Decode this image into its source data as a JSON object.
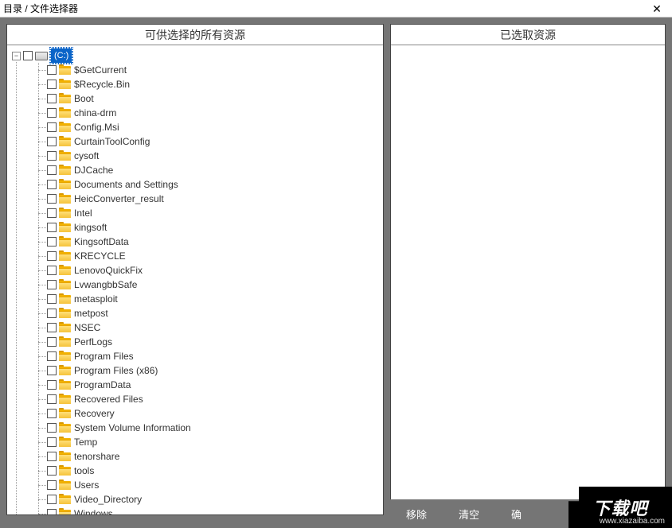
{
  "window": {
    "title": "目录 / 文件选择器"
  },
  "panels": {
    "left_header": "可供选择的所有资源",
    "right_header": "已选取资源"
  },
  "tree": {
    "root": {
      "label": "(C:)"
    },
    "nodes": [
      {
        "label": "$GetCurrent"
      },
      {
        "label": "$Recycle.Bin"
      },
      {
        "label": "Boot"
      },
      {
        "label": "china-drm"
      },
      {
        "label": "Config.Msi"
      },
      {
        "label": "CurtainToolConfig"
      },
      {
        "label": "cysoft"
      },
      {
        "label": "DJCache"
      },
      {
        "label": "Documents and Settings"
      },
      {
        "label": "HeicConverter_result"
      },
      {
        "label": "Intel"
      },
      {
        "label": "kingsoft"
      },
      {
        "label": "KingsoftData"
      },
      {
        "label": "KRECYCLE"
      },
      {
        "label": "LenovoQuickFix"
      },
      {
        "label": "LvwangbbSafe"
      },
      {
        "label": "metasploit"
      },
      {
        "label": "metpost"
      },
      {
        "label": "NSEC"
      },
      {
        "label": "PerfLogs"
      },
      {
        "label": "Program Files"
      },
      {
        "label": "Program Files (x86)"
      },
      {
        "label": "ProgramData"
      },
      {
        "label": "Recovered Files"
      },
      {
        "label": "Recovery"
      },
      {
        "label": "System Volume Information"
      },
      {
        "label": "Temp"
      },
      {
        "label": "tenorshare"
      },
      {
        "label": "tools"
      },
      {
        "label": "Users"
      },
      {
        "label": "Video_Directory"
      },
      {
        "label": "Windows"
      }
    ]
  },
  "buttons": {
    "remove": "移除",
    "clear": "清空",
    "confirm": "确"
  },
  "watermark": {
    "logo_text": "下载吧",
    "domain": "www.xiazaiba.com"
  }
}
